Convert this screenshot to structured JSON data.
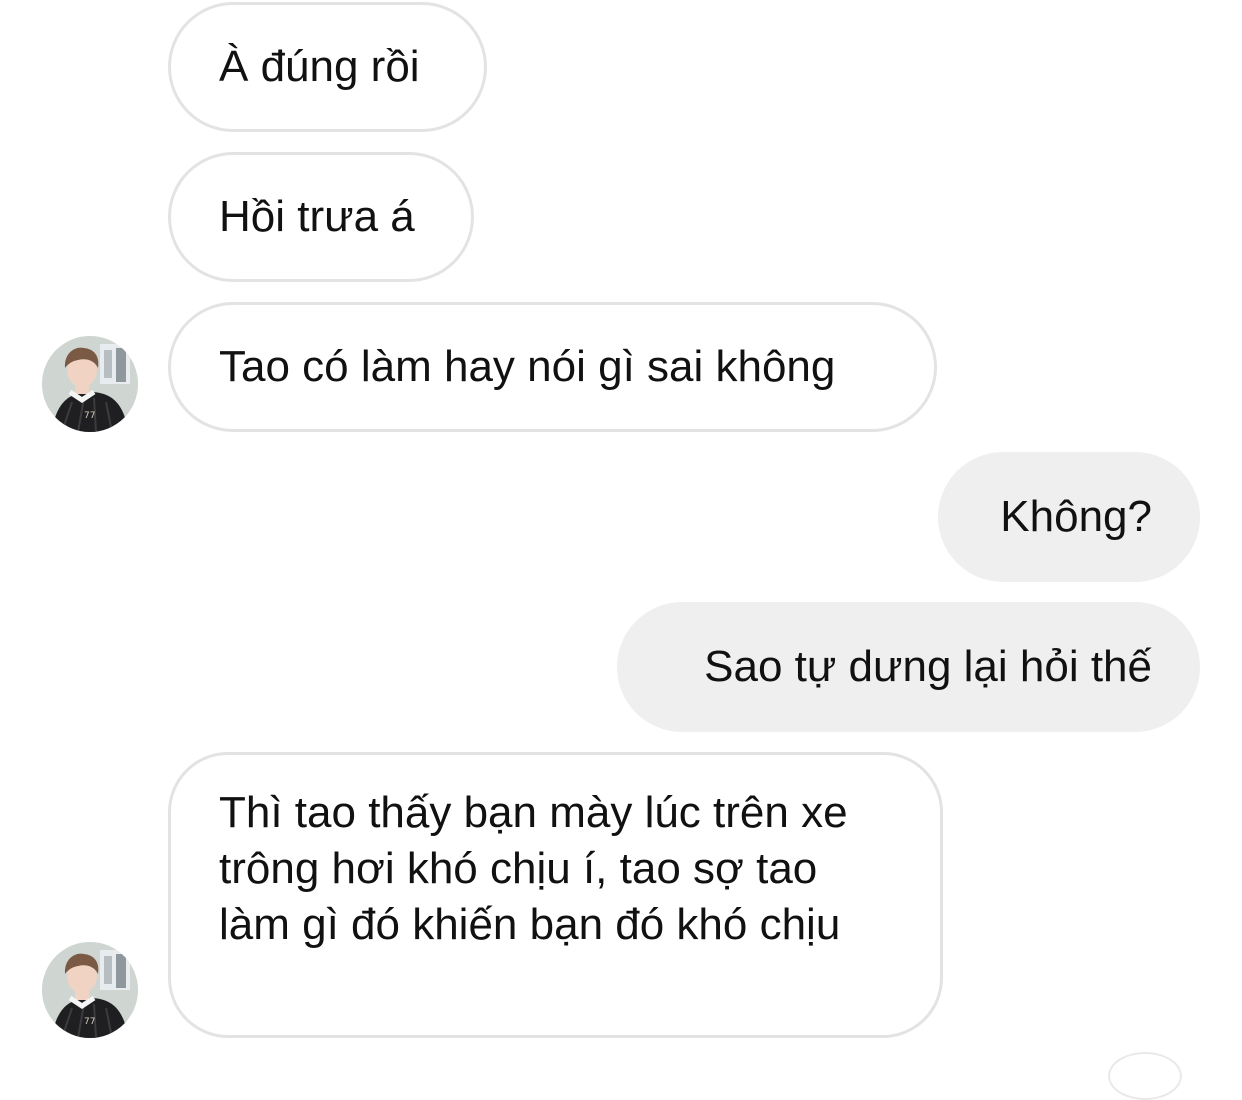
{
  "messages": [
    {
      "side": "incoming",
      "text": "À đúng rồi"
    },
    {
      "side": "incoming",
      "text": "Hồi trưa á"
    },
    {
      "side": "incoming",
      "text": "Tao có làm hay nói gì sai không"
    },
    {
      "side": "outgoing",
      "text": "Không?"
    },
    {
      "side": "outgoing",
      "text": "Sao tự dưng lại hỏi thế"
    },
    {
      "side": "incoming",
      "text": "Thì tao thấy bạn mày lúc trên xe trông hơi khó chịu í, tao sợ tao làm gì đó khiến bạn đó khó chịu"
    }
  ],
  "avatar": {
    "icon": "person-photo-avatar",
    "jersey_number": "77"
  },
  "colors": {
    "incoming_bg": "#ffffff",
    "incoming_border": "#e3e3e3",
    "outgoing_bg": "#efefef",
    "text": "#111111"
  }
}
